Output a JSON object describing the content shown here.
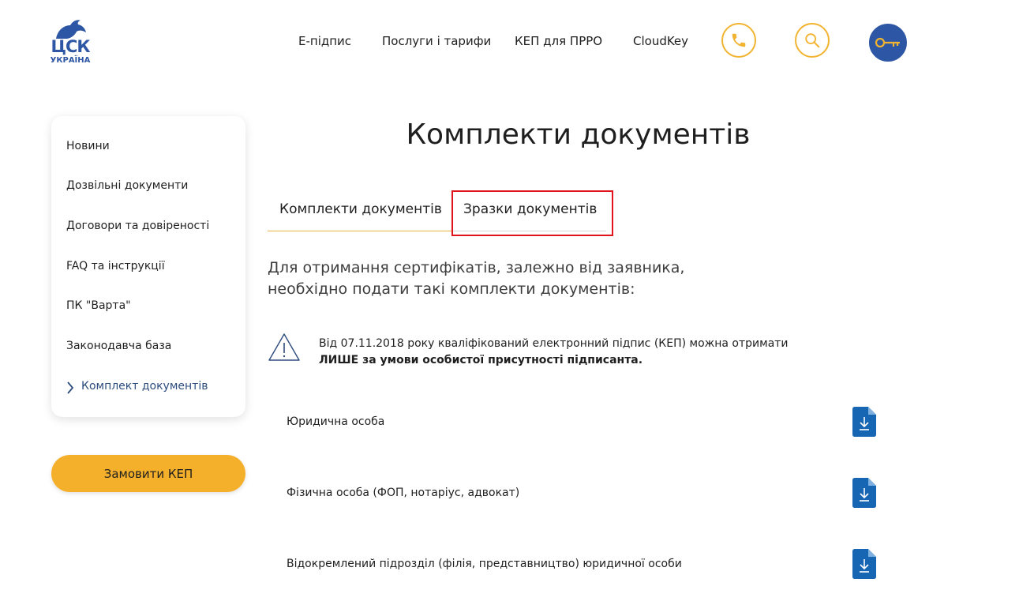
{
  "header": {
    "logo": {
      "text": "ЦСК",
      "subtext": "УКРАЇНА"
    },
    "nav": [
      {
        "label": "Е-підпис"
      },
      {
        "label": "Послуги і тарифи"
      },
      {
        "label": "КЕП для ПРРО"
      },
      {
        "label": "CloudKey"
      }
    ],
    "icons": [
      "phone-icon",
      "search-icon",
      "key-icon"
    ]
  },
  "sidebar": {
    "items": [
      {
        "label": "Новини"
      },
      {
        "label": "Дозвільні документи"
      },
      {
        "label": "Договори та довіреності"
      },
      {
        "label": "FAQ та інструкції"
      },
      {
        "label": "ПК \"Варта\""
      },
      {
        "label": "Законодавча база"
      },
      {
        "label": "Комплект документів",
        "active": true
      }
    ],
    "order_button": "Замовити КЕП"
  },
  "main": {
    "title": "Комплекти документів",
    "tabs": [
      {
        "label": "Комплекти документів",
        "active": true
      },
      {
        "label": "Зразки документів",
        "active": false
      }
    ],
    "intro": "Для отримання сертифікатів, залежно від заявника, необхідно подати такі комплекти документів:",
    "warning": {
      "text": "Від 07.11.2018 року кваліфікований електронний підпис (КЕП) можна отримати",
      "bold": "ЛИШЕ за умови особистої присутності підписанта."
    },
    "documents": [
      {
        "label": "Юридична особа",
        "icon": "download-file-icon"
      },
      {
        "label": "Фізична особа (ФОП, нотаріус, адвокат)",
        "icon": "download-file-icon"
      },
      {
        "label": "Відокремлений підрозділ (філія, представництво) юридичної особи",
        "icon": "download-file-icon"
      }
    ]
  },
  "colors": {
    "brand_blue": "#2d57a4",
    "accent_yellow": "#f5b02b",
    "highlight_red": "#e1141d",
    "download_blue": "#1766b3"
  }
}
